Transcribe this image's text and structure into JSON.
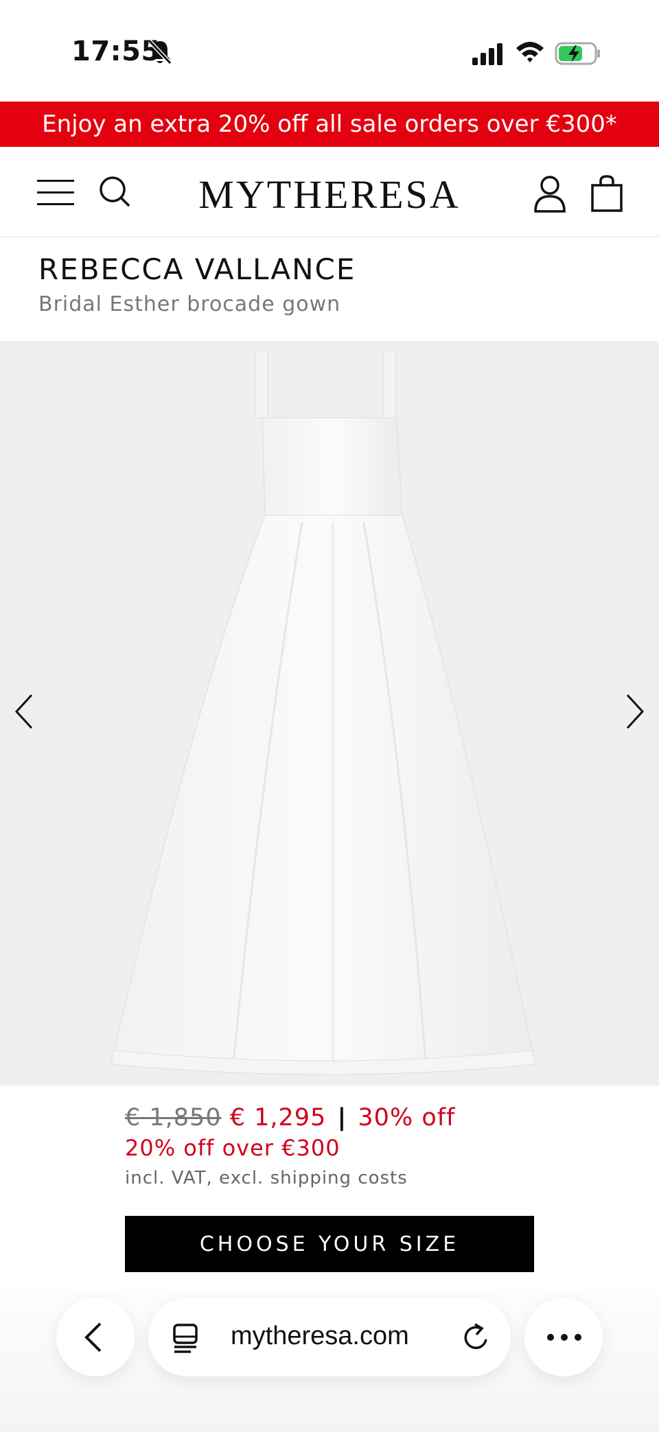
{
  "status_bar": {
    "time": "17:55"
  },
  "promo_banner": {
    "text": "Enjoy an extra 20% off all sale orders over €300*"
  },
  "header": {
    "logo": "MYTHERESA"
  },
  "product": {
    "brand": "REBECCA VALLANCE",
    "name": "Bridal Esther brocade gown",
    "original_price": "€ 1,850",
    "sale_price": "€ 1,295",
    "discount": "30% off",
    "extra_offer": "20% off over €300",
    "tax_note": "incl. VAT, excl. shipping costs",
    "cta_label": "CHOOSE YOUR SIZE"
  },
  "browser": {
    "url": "mytheresa.com"
  },
  "colors": {
    "promo": "#e3000f",
    "sale": "#d0021b",
    "cta": "#000000"
  }
}
